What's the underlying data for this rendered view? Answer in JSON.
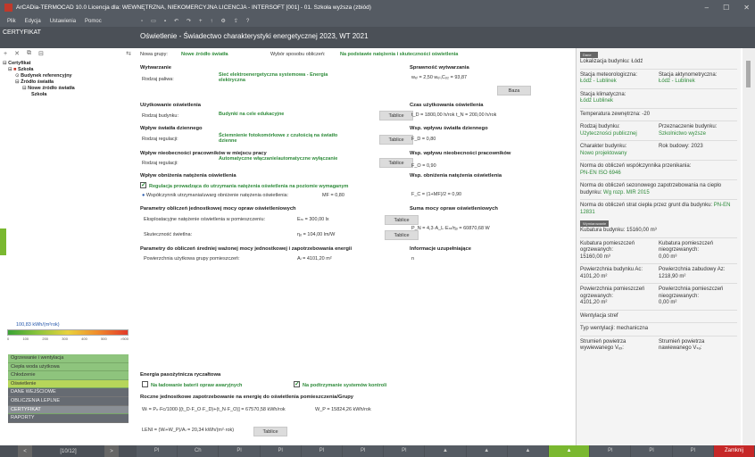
{
  "title": "ArCADia-TERMOCAD 10.0 Licencja dla: WEWNĘTRZNA, NIEKOMERCYJNA LICENCJA - INTERSOFT [001] - 01. Szkoła wyższa (zbiód)",
  "window_controls": [
    "–",
    "☐",
    "✕"
  ],
  "menu": [
    "Plik",
    "Edycja",
    "Ustawienia",
    "Pomoc"
  ],
  "toolbar_icons": [
    "new",
    "open",
    "save",
    "undo",
    "redo",
    "add",
    "up",
    "settings",
    "export",
    "help"
  ],
  "left_header": "CERTYFIKAT",
  "main_header": "Oświetlenie - Świadectwo charakterystyki energetycznej 2023, WT 2021",
  "left_tools": [
    "+",
    "✕",
    "⧉",
    "⊟",
    "⇆"
  ],
  "tree": {
    "root": "Certyfikat",
    "school": "Szkoła",
    "building_ref": "Budynek referencyjny",
    "light_src": "Źródło światła",
    "new_light": "Nowe źródło światła",
    "school2": "Szkoła"
  },
  "energy": {
    "value": "100,83 kWh/(m²rok)",
    "ticks": [
      "0",
      "100",
      "200",
      "300",
      "400",
      "500",
      ">500"
    ]
  },
  "nav": [
    "Ogrzewanie i wentylacja",
    "Ciepła woda użytkowa",
    "Chłodzenie",
    "Oświetlenie",
    "DANE WEJŚCIOWE",
    "OBLICZENIA LEPLNE",
    "CERTYFIKAT",
    "RAPORTY"
  ],
  "pager": {
    "label": "[10/12]",
    "prev": "<",
    "next": ">"
  },
  "main": {
    "group_label": "Nowa grupy:",
    "group_value": "Nowe źródło światła",
    "method_label": "Wybór sposobu obliczeń:",
    "method_value": "Na podstawie natężenia i skuteczności oświetlenia",
    "s_production": "Wytwarzanie",
    "fuel_label": "Rodzaj paliwa:",
    "fuel_value": "Sieć elektroenergetyczna systemowa - Energia elektryczna",
    "s_usage": "Użytkowanie oświetlenia",
    "building_type_label": "Rodzaj budynku:",
    "building_type_value": "Budynki na cele edukacyjne",
    "table_btn": "Tablice",
    "s_daylight": "Wpływ światła dziennego",
    "reg1_label": "Rodzaj regulacji:",
    "reg1_value": "Ściemnienie fotokomórkowe z czułością na światło dzienne",
    "s_absence": "Wpływ nieobecności pracowników w miejscu pracy",
    "reg2_label": "Rodzaj regulacji:",
    "reg2_value": "Automatyczne włączanie/automatyczne wyłączanie",
    "s_reduction": "Wpływ obniżenia natężenia oświetlenia",
    "reg_check": "Regulacja prowadząca do utrzymania natężenia oświetlenia na poziomie wymaganym",
    "mf_label": "Współczynnik utrzymania/uwarg obniżenie natężenia oświetlenia:",
    "mf_value": "MF = 0,80",
    "s_params1": "Parametry obliczeń jednostkowej mocy opraw oświetleniowych",
    "em_label": "Eksploatacyjne natężenie oświetlenia w pomieszczeniu:",
    "em_value": "Eₘ = 300,00 lx",
    "eta_label": "Skuteczność świetlna:",
    "eta_value": "ηₒ = 104,00 lm/W",
    "s_params2": "Parametry do obliczeń średniej ważonej mocy jednostkowej i zapotrzebowania energii",
    "area_label": "Powierzchnia użytkowa grupy pomieszczeń:",
    "area_value": "Aₗ = 4101,20 m²",
    "s_eff": "Sprawność wytwarzania",
    "eff_formula": "wₑₗ = 2,50    wₑₗ,Cₒ₂ = 93,87",
    "baza_btn": "Baza",
    "s_time": "Czas użytkowania oświetlenia",
    "time_formula": "t_D = 1800,00 h/rok    t_N = 200,00 h/rok",
    "s_daylight_f": "Wsp. wpływu światła dziennego",
    "fd": "F_D = 0,80",
    "s_absence_f": "Wsp. wpływu nieobecności pracowników",
    "fo": "F_O = 0,90",
    "s_reduction_f": "Wsp. obniżenia natężenia oświetlenia",
    "fc": "F_C = (1+MF)/2 = 0,90",
    "s_power": "Suma mocy opraw oświetleniowych",
    "power_formula": "P_N = 4,3·A_L·Eₘ/ηₒ = 60870,68 W",
    "s_info": "Informacje uzupełniające",
    "info_val": "n",
    "s_parasitic": "Energia pasożytnicza ryczałtowa",
    "charge_check": "Na ładowanie baterii opraw awaryjnych",
    "control_check": "Na podtrzymanie systemów kontroli",
    "s_annual": "Roczne jednostkowe zapotrzebowanie na energię do oświetlenia pomieszczenia/Grupy",
    "wl_formula": "Wₗ = Pₙ·Fc/1000·[(t_D·F_O·F_D)+(t_N·F_O)] = 67570,58 kWh/rok",
    "wp_formula": "W_P = 15824,26 kWh/rok",
    "leni_formula": "LENI = (Wₗ+W_P)/Aₗ = 20,34 kWh/(m²·rok)"
  },
  "right": {
    "hdr1": "Dane ogólne",
    "hdr2": "Wymiarowanie",
    "location": "Lokalizacja budynku: Łódź",
    "met_label": "Stacja meteorologiczna:",
    "met_value": "Łódź - Lublinek",
    "act_label": "Stacja aktynometryczna:",
    "act_value": "Łódź - Lublinek",
    "clim_label": "Stacja klimatyczna:",
    "clim_value": "Łódź Lublinek",
    "temp": "Temperatura zewnętrzna: -20",
    "btype_label": "Rodzaj budynku:",
    "btype_value": "Użyteczności publicznej",
    "purpose_label": "Przeznaczenie budynku:",
    "purpose_value": "Szkolnictwo wyższe",
    "char_label": "Charakter budynku:",
    "char_value": "Nowo projektowany",
    "year": "Rok budowy: 2023",
    "norm1_label": "Norma do obliczeń współczynnika przenikania:",
    "norm1_value": "PN-EN ISO 6946",
    "norm2_label": "Norma do obliczeń sezonowego zapotrzebowania na ciepło budynku:",
    "norm2_value": "Wg rozp. MIR 2015",
    "norm3_label": "Norma do obliczeń strat ciepła przez grunt dla budynku:",
    "norm3_value": "PN-EN 12831",
    "cubature": "Kubatura budynku: 15160,00 m³",
    "cub_heated_label": "Kubatura pomieszczeń ogrzewanych:",
    "cub_heated_value": "15160,00 m³",
    "cub_unheated_label": "Kubatura pomieszczeń nieogrzewanych:",
    "cub_unheated_value": "0,00 m³",
    "area_b_label": "Powierzchnia budynku Ac:",
    "area_b_value": "4101,20 m²",
    "area_dev_label": "Powierzchnia zabudowy Az:",
    "area_dev_value": "1218,90 m²",
    "area_heated_label": "Powierzchnia pomieszczeń ogrzewanych:",
    "area_heated_value": "4101,20 m²",
    "area_unheated_label": "Powierzchnia pomieszczeń nieogrzewanych:",
    "area_unheated_value": "0,00 m²",
    "vent_zones": "Wentylacja stref",
    "vent_type": "Typ wentylacji: mechaniczna",
    "flow_out_label": "Strumień powietrza wywiewanego Vₑₓ:",
    "flow_in_label": "Strumień powietrza nawiewanego Vₛᵤ:"
  },
  "bottom": [
    "Pl",
    "Ch",
    "Pl",
    "Pl",
    "Pl",
    "Pl",
    "Pl",
    "▲",
    "▲",
    "▲",
    "▲",
    "Pl",
    "Pl",
    "Pl",
    "Zamknij"
  ]
}
